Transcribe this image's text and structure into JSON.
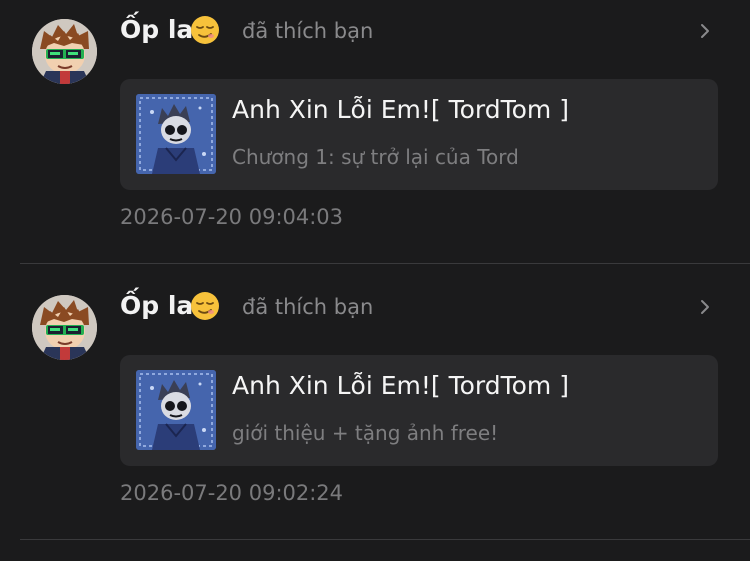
{
  "notifications": [
    {
      "user": "Ốp la",
      "emoji_icon": "relieved-face-emoji",
      "action": "đã thích bạn",
      "story_title": "Anh Xin Lỗi Em![ TordTom ]",
      "chapter": "Chương 1: sự trở lại của Tord",
      "time": "2026-07-20 09:04:03"
    },
    {
      "user": "Ốp la",
      "emoji_icon": "relieved-face-emoji",
      "action": "đã thích bạn",
      "story_title": "Anh Xin Lỗi Em![ TordTom ]",
      "chapter": "giới thiệu + tặng ảnh free!",
      "time": "2026-07-20 09:02:24"
    }
  ],
  "colors": {
    "background": "#1b1b1c",
    "card": "#2a2a2c",
    "primary_text": "#f2f2f2",
    "secondary_text": "#8a8a8c",
    "divider": "#3a3a3c"
  }
}
